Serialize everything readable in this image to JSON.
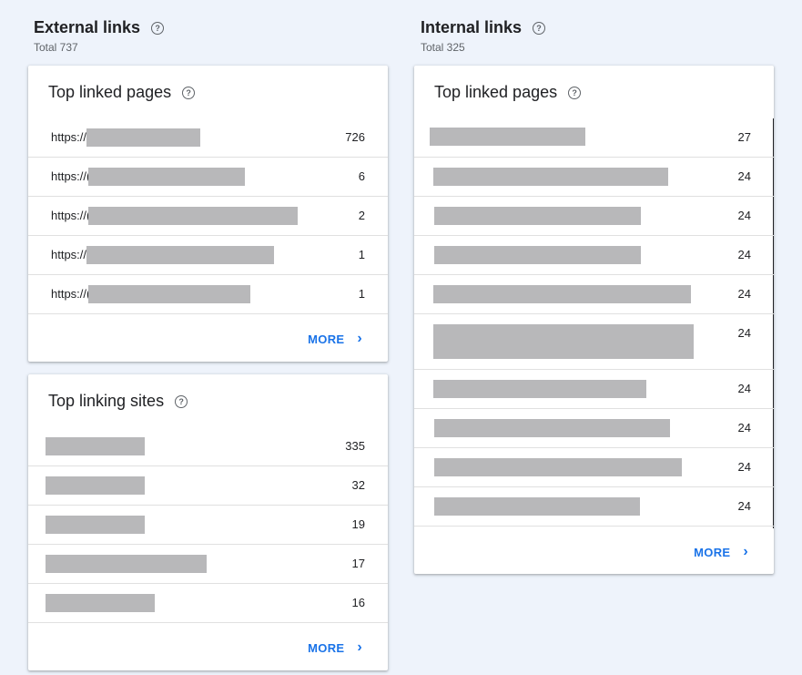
{
  "external": {
    "title": "External links",
    "total": "Total 737",
    "top_linked_pages": {
      "title": "Top linked pages",
      "rows": [
        {
          "url": "https://",
          "count": "726"
        },
        {
          "url": "https://(",
          "count": "6"
        },
        {
          "url": "https://(",
          "count": "2"
        },
        {
          "url": "https://",
          "count": "1"
        },
        {
          "url": "https://(",
          "count": "1"
        }
      ],
      "more_label": "MORE"
    },
    "top_linking_sites": {
      "title": "Top linking sites",
      "rows": [
        {
          "count": "335"
        },
        {
          "count": "32"
        },
        {
          "count": "19"
        },
        {
          "count": "17"
        },
        {
          "count": "16"
        }
      ],
      "more_label": "MORE"
    }
  },
  "internal": {
    "title": "Internal links",
    "total": "Total 325",
    "top_linked_pages": {
      "title": "Top linked pages",
      "rows": [
        {
          "count": "27"
        },
        {
          "count": "24"
        },
        {
          "count": "24"
        },
        {
          "count": "24"
        },
        {
          "count": "24"
        },
        {
          "count": "24"
        },
        {
          "count": "24"
        },
        {
          "count": "24"
        },
        {
          "count": "24"
        },
        {
          "count": "24"
        }
      ],
      "more_label": "MORE"
    }
  },
  "icons": {
    "help": "help-circle-icon",
    "more": "chevron-right-icon"
  },
  "colors": {
    "background": "#eef3fb",
    "accent": "#1a73e8",
    "redaction": "#b8b8ba"
  }
}
